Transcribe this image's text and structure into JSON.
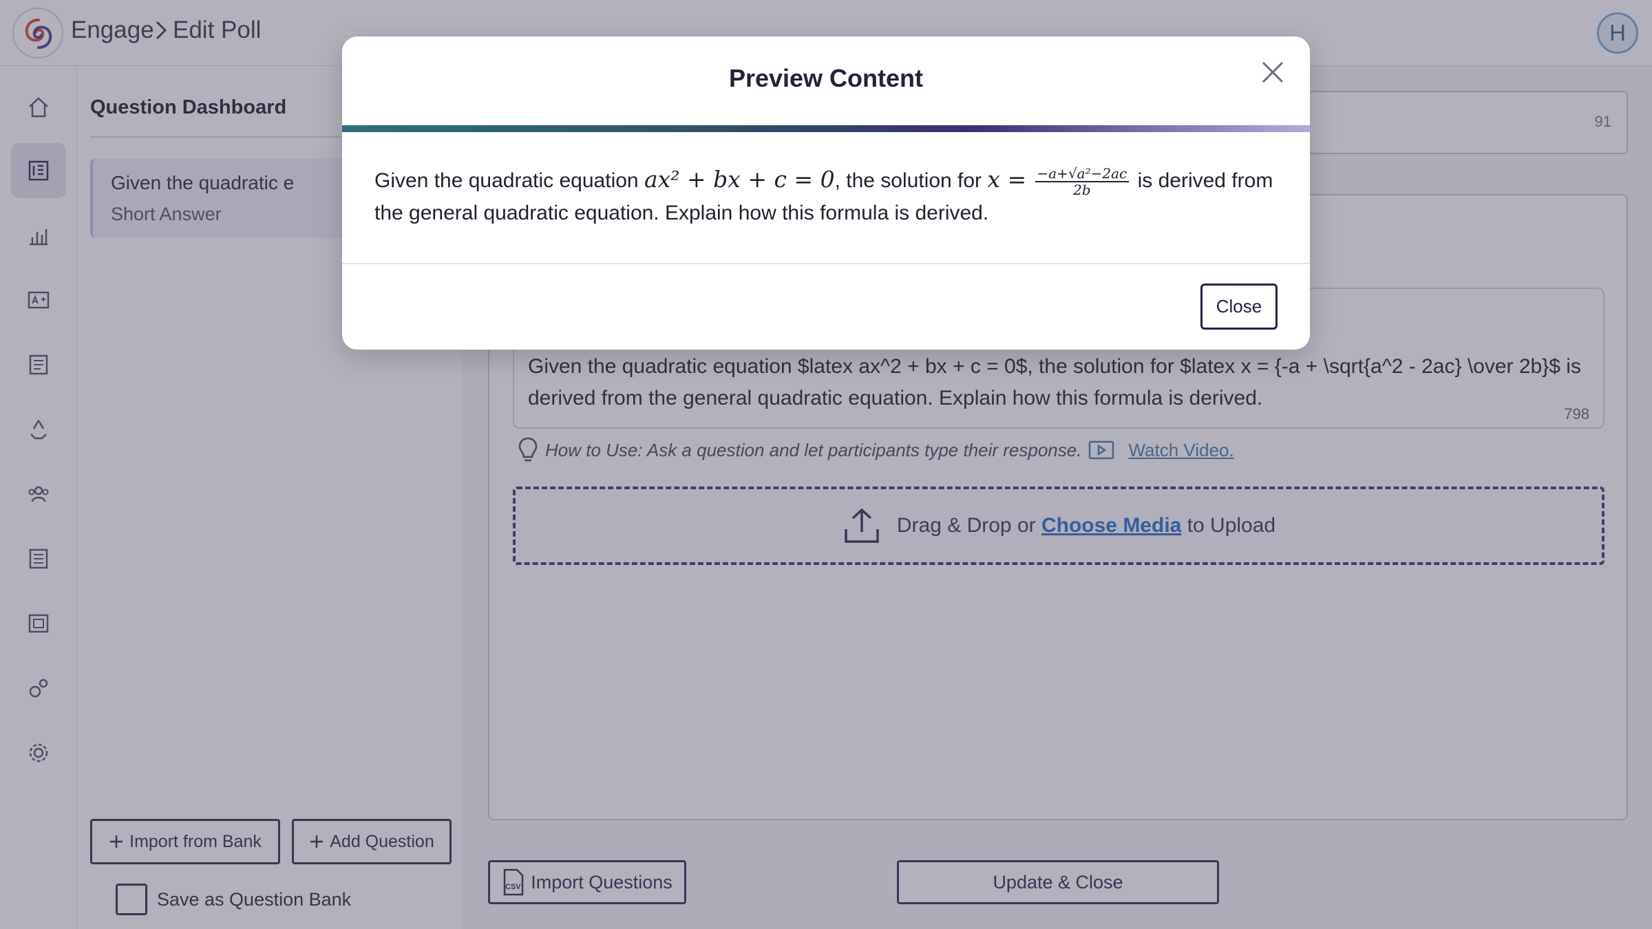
{
  "header": {
    "breadcrumb": [
      "Engage",
      "Edit Poll"
    ],
    "user_initial": "H"
  },
  "sidebar": {
    "items": [
      {
        "icon": "home-icon"
      },
      {
        "icon": "dashboard-icon",
        "active": true
      },
      {
        "icon": "bar-chart-icon"
      },
      {
        "icon": "grade-icon"
      },
      {
        "icon": "report-icon"
      },
      {
        "icon": "recycle-icon"
      },
      {
        "icon": "group-icon"
      },
      {
        "icon": "list-icon"
      },
      {
        "icon": "gallery-icon"
      },
      {
        "icon": "gears-icon"
      },
      {
        "icon": "settings-icon"
      }
    ]
  },
  "question_dashboard": {
    "title": "Question Dashboard",
    "questions": [
      {
        "title": "Given the quadratic e",
        "type": "Short Answer"
      }
    ],
    "import_from_bank_label": "Import from Bank",
    "add_question_label": "Add Question",
    "save_as_bank_label": "Save as Question Bank"
  },
  "editor": {
    "title_char_count": "91",
    "question_text": "Given the quadratic equation $latex ax^2 + bx + c = 0$, the solution for $latex x = {-a + \\sqrt{a^2 - 2ac} \\over 2b}$ is derived from the general quadratic equation. Explain how this formula is derived.",
    "question_char_count": "798",
    "how_to_use": "How to Use: Ask a question and let participants type their response.",
    "watch_video_label": "Watch Video.",
    "upload": {
      "prefix": "Drag & Drop or",
      "link": "Choose Media",
      "suffix": "to Upload"
    },
    "import_questions_label": "Import Questions",
    "update_close_label": "Update & Close"
  },
  "modal": {
    "title": "Preview Content",
    "body_part1": "Given the quadratic equation",
    "math_eq": "ax² + bx + c = 0",
    "body_part2": ", the solution for",
    "math_x": "x =",
    "frac_num": "−a+√a²−2ac",
    "frac_den": "2b",
    "body_part3": "is derived from the general quadratic equation. Explain how this formula is derived.",
    "close_label": "Close"
  },
  "colors": {
    "accent_dark": "#2f2f4a",
    "link_blue": "#2f6fc9",
    "gradient_start": "#2f6f78",
    "gradient_end": "#b7a8dc"
  }
}
